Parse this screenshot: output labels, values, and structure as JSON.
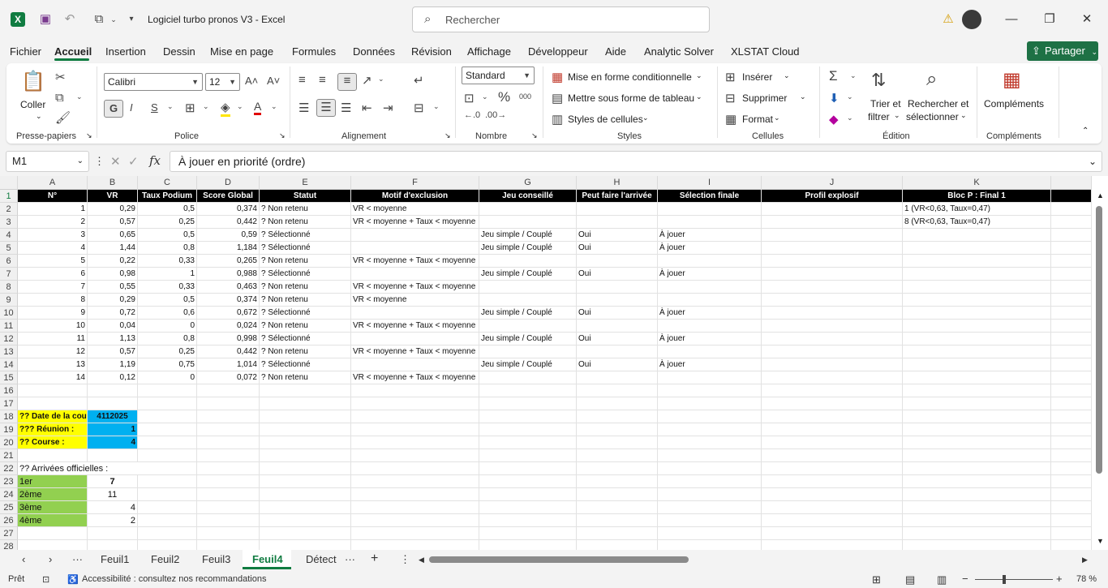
{
  "title_bar": {
    "doc_title": "Logiciel turbo pronos V3  -  Excel",
    "search_placeholder": "Rechercher"
  },
  "menu": {
    "tabs": [
      "Fichier",
      "Accueil",
      "Insertion",
      "Dessin",
      "Mise en page",
      "Formules",
      "Données",
      "Révision",
      "Affichage",
      "Développeur",
      "Aide",
      "Analytic Solver",
      "XLSTAT Cloud"
    ],
    "active": "Accueil",
    "share_label": "Partager"
  },
  "ribbon": {
    "clipboard": {
      "paste": "Coller",
      "group": "Presse-papiers"
    },
    "font": {
      "name": "Calibri",
      "size": "12",
      "bold": "G",
      "italic": "I",
      "underline": "S",
      "group": "Police"
    },
    "alignment": {
      "group": "Alignement"
    },
    "number": {
      "format": "Standard",
      "percent": "%",
      "thousands": "000",
      "group": "Nombre"
    },
    "styles": {
      "conditional": "Mise en forme conditionnelle",
      "table": "Mettre sous forme de tableau",
      "cell_styles": "Styles de cellules",
      "group": "Styles"
    },
    "cells": {
      "insert": "Insérer",
      "delete": "Supprimer",
      "format": "Format",
      "group": "Cellules"
    },
    "editing": {
      "sort1": "Trier et",
      "sort2": "filtrer",
      "find1": "Rechercher et",
      "find2": "sélectionner",
      "group": "Édition"
    },
    "addins": {
      "label": "Compléments",
      "group": "Compléments"
    }
  },
  "formula_bar": {
    "name_box": "M1",
    "fx": "fx",
    "content": "À jouer en priorité (ordre)"
  },
  "columns": [
    "A",
    "B",
    "C",
    "D",
    "E",
    "F",
    "G",
    "H",
    "I",
    "J",
    "K"
  ],
  "header_row": [
    "N°",
    "VR",
    "Taux Podium",
    "Score Global",
    "Statut",
    "Motif d'exclusion",
    "Jeu conseillé",
    "Peut faire l'arrivée",
    "Sélection finale",
    "Profil explosif",
    "Bloc P : Final 1"
  ],
  "rows": [
    [
      "1",
      "0,29",
      "0,5",
      "0,374",
      "? Non retenu",
      "VR < moyenne",
      "",
      "",
      "",
      "",
      "1 (VR<0,63, Taux=0,47)"
    ],
    [
      "2",
      "0,57",
      "0,25",
      "0,442",
      "? Non retenu",
      "VR < moyenne + Taux < moyenne",
      "",
      "",
      "",
      "",
      "8 (VR<0,63, Taux=0,47)"
    ],
    [
      "3",
      "0,65",
      "0,5",
      "0,59",
      "? Sélectionné",
      "",
      "Jeu simple / Couplé",
      "Oui",
      "À jouer",
      "",
      ""
    ],
    [
      "4",
      "1,44",
      "0,8",
      "1,184",
      "? Sélectionné",
      "",
      "Jeu simple / Couplé",
      "Oui",
      "À jouer",
      "",
      ""
    ],
    [
      "5",
      "0,22",
      "0,33",
      "0,265",
      "? Non retenu",
      "VR < moyenne + Taux < moyenne",
      "",
      "",
      "",
      "",
      ""
    ],
    [
      "6",
      "0,98",
      "1",
      "0,988",
      "? Sélectionné",
      "",
      "Jeu simple / Couplé",
      "Oui",
      "À jouer",
      "",
      ""
    ],
    [
      "7",
      "0,55",
      "0,33",
      "0,463",
      "? Non retenu",
      "VR < moyenne + Taux < moyenne",
      "",
      "",
      "",
      "",
      ""
    ],
    [
      "8",
      "0,29",
      "0,5",
      "0,374",
      "? Non retenu",
      "VR < moyenne",
      "",
      "",
      "",
      "",
      ""
    ],
    [
      "9",
      "0,72",
      "0,6",
      "0,672",
      "? Sélectionné",
      "",
      "Jeu simple / Couplé",
      "Oui",
      "À jouer",
      "",
      ""
    ],
    [
      "10",
      "0,04",
      "0",
      "0,024",
      "? Non retenu",
      "VR < moyenne + Taux < moyenne",
      "",
      "",
      "",
      "",
      ""
    ],
    [
      "11",
      "1,13",
      "0,8",
      "0,998",
      "? Sélectionné",
      "",
      "Jeu simple / Couplé",
      "Oui",
      "À jouer",
      "",
      ""
    ],
    [
      "12",
      "0,57",
      "0,25",
      "0,442",
      "? Non retenu",
      "VR < moyenne + Taux < moyenne",
      "",
      "",
      "",
      "",
      ""
    ],
    [
      "13",
      "1,19",
      "0,75",
      "1,014",
      "? Sélectionné",
      "",
      "Jeu simple / Couplé",
      "Oui",
      "À jouer",
      "",
      ""
    ],
    [
      "14",
      "0,12",
      "0",
      "0,072",
      "? Non retenu",
      "VR < moyenne + Taux < moyenne",
      "",
      "",
      "",
      "",
      ""
    ]
  ],
  "info_block": [
    {
      "label": "?? Date de la course :",
      "value": "4112025"
    },
    {
      "label": "??? Réunion :",
      "value": "1"
    },
    {
      "label": "?? Course :",
      "value": "4"
    }
  ],
  "arrivals_title": "?? Arrivées officielles :",
  "arrivals": [
    {
      "label": "1er",
      "value": "7"
    },
    {
      "label": "2ème",
      "value": "11"
    },
    {
      "label": "3ème",
      "value": "4"
    },
    {
      "label": "4ème",
      "value": "2"
    }
  ],
  "row_numbers": [
    "1",
    "2",
    "3",
    "4",
    "5",
    "6",
    "7",
    "8",
    "9",
    "10",
    "11",
    "12",
    "13",
    "14",
    "15",
    "16",
    "17",
    "18",
    "19",
    "20",
    "21",
    "22",
    "23",
    "24",
    "25",
    "26",
    "27",
    "28"
  ],
  "sheets": [
    "Feuil1",
    "Feuil2",
    "Feuil3",
    "Feuil4",
    "Détect"
  ],
  "active_sheet": "Feuil4",
  "status": {
    "ready": "Prêt",
    "accessibility": "Accessibilité : consultez nos recommandations",
    "zoom": "78 %",
    "zoom_level": 0.78
  },
  "colors": {
    "excel_green": "#107c41",
    "share_bg": "#1e7145",
    "yellow": "#ffff00",
    "blue": "#00b0f0",
    "green": "#92d050",
    "header_black": "#000000"
  }
}
